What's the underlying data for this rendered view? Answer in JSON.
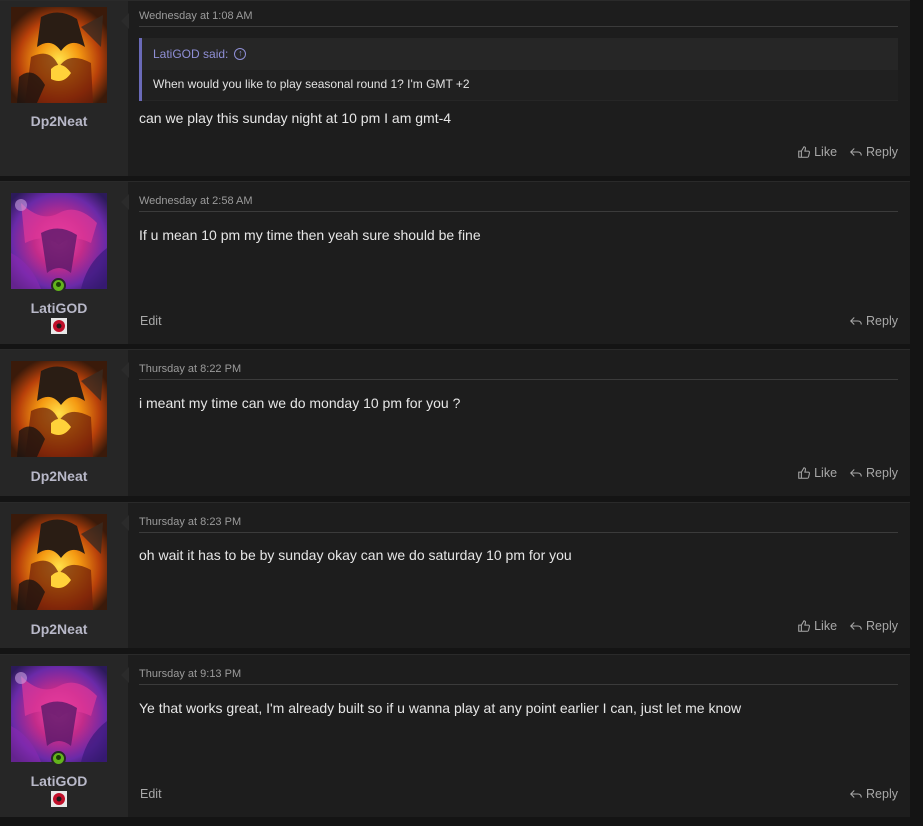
{
  "posts": [
    {
      "username": "Dp2Neat",
      "timestamp": "Wednesday at 1:08 AM",
      "quote": {
        "author": "LatiGOD said:",
        "text": "When would you like to play seasonal round 1? I'm GMT +2"
      },
      "message": "can we play this sunday night at 10 pm I am gmt-4",
      "like_label": "Like",
      "reply_label": "Reply"
    },
    {
      "username": "LatiGOD",
      "timestamp": "Wednesday at 2:58 AM",
      "message": "If u mean 10 pm my time then yeah sure should be fine",
      "edit_label": "Edit",
      "reply_label": "Reply"
    },
    {
      "username": "Dp2Neat",
      "timestamp": "Thursday at 8:22 PM",
      "message": "i meant my time can we do monday 10 pm for you ?",
      "like_label": "Like",
      "reply_label": "Reply"
    },
    {
      "username": "Dp2Neat",
      "timestamp": "Thursday at 8:23 PM",
      "message": "oh wait it has to be by sunday okay can we do saturday 10 pm for you",
      "like_label": "Like",
      "reply_label": "Reply"
    },
    {
      "username": "LatiGOD",
      "timestamp": "Thursday at 9:13 PM",
      "message": "Ye that works great, I'm already built so if u wanna play at any point earlier I can, just let me know",
      "edit_label": "Edit",
      "reply_label": "Reply"
    }
  ],
  "icons": {
    "like": "thumbs-up-icon",
    "reply": "reply-arrow-icon",
    "quote_jump": "arrow-up-circle-icon",
    "online": "online-status-icon",
    "badge": "user-badge-icon"
  },
  "colors": {
    "quote_accent": "#6a6ab8",
    "online": "#63b31c",
    "post_bg": "#1d1d1d",
    "user_bg": "#262626"
  }
}
